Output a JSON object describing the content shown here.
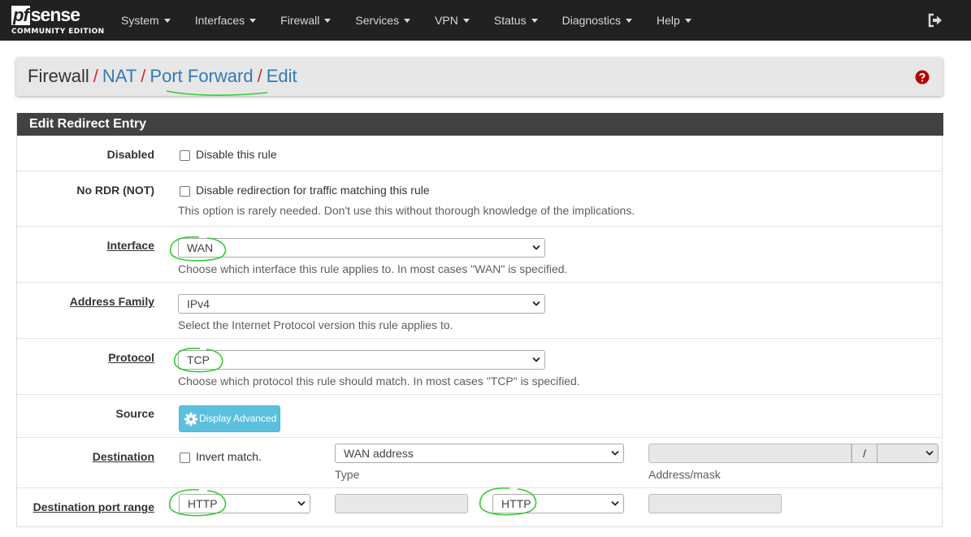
{
  "navbar": {
    "logo_pf": "pf",
    "logo_sense": "sense",
    "logo_edition": "COMMUNITY EDITION",
    "menu": [
      {
        "label": "System"
      },
      {
        "label": "Interfaces"
      },
      {
        "label": "Firewall"
      },
      {
        "label": "Services"
      },
      {
        "label": "VPN"
      },
      {
        "label": "Status"
      },
      {
        "label": "Diagnostics"
      },
      {
        "label": "Help"
      }
    ],
    "logout_icon": "sign-out-icon"
  },
  "breadcrumb": {
    "items": [
      "Firewall",
      "NAT",
      "Port Forward",
      "Edit"
    ],
    "separator": "/",
    "help_icon": "question-circle-icon"
  },
  "panel": {
    "title": "Edit Redirect Entry"
  },
  "form": {
    "disabled": {
      "label": "Disabled",
      "checkbox_label": "Disable this rule",
      "checked": false
    },
    "no_rdr": {
      "label": "No RDR (NOT)",
      "checkbox_label": "Disable redirection for traffic matching this rule",
      "help": "This option is rarely needed. Don't use this without thorough knowledge of the implications.",
      "checked": false
    },
    "interface": {
      "label": "Interface",
      "value": "WAN",
      "help": "Choose which interface this rule applies to. In most cases \"WAN\" is specified."
    },
    "address_family": {
      "label": "Address Family",
      "value": "IPv4",
      "help": "Select the Internet Protocol version this rule applies to."
    },
    "protocol": {
      "label": "Protocol",
      "value": "TCP",
      "help": "Choose which protocol this rule should match. In most cases \"TCP\" is specified."
    },
    "source": {
      "label": "Source",
      "button_label": "Display Advanced",
      "button_icon": "gear-icon"
    },
    "destination": {
      "label": "Destination",
      "invert_label": "Invert match.",
      "type_value": "WAN address",
      "type_label": "Type",
      "address_value": "",
      "mask_separator": "/",
      "mask_value": "",
      "address_label": "Address/mask"
    },
    "dest_port_range": {
      "label": "Destination port range",
      "from_value": "HTTP",
      "from_custom": "",
      "to_value": "HTTP",
      "to_custom": ""
    }
  },
  "colors": {
    "navbar_bg": "#212121",
    "breadcrumb_sep": "#c9302c",
    "link": "#337ab7",
    "panel_heading_bg": "#424242",
    "button_info": "#5bc0de",
    "annotation": "#33cc33"
  }
}
